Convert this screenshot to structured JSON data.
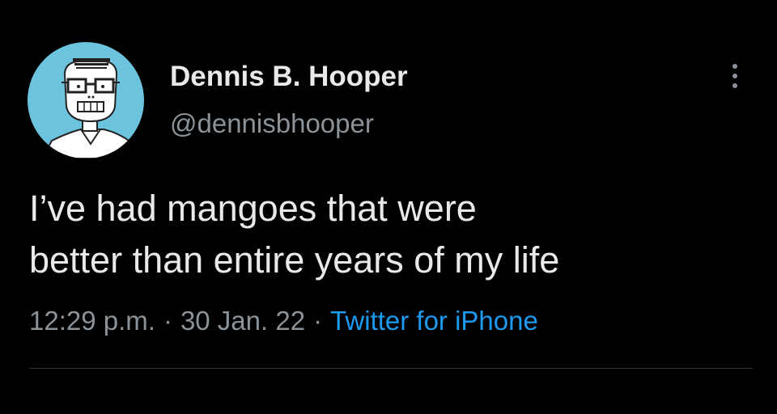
{
  "author": {
    "display_name": "Dennis B. Hooper",
    "handle": "@dennisbhooper",
    "avatar_icon": "cartoon-face-avatar",
    "avatar_bg": "#6cc3dd"
  },
  "more_icon": "more-options-icon",
  "tweet": {
    "lines": [
      "I’ve had mangoes that were",
      "better than entire years of my life"
    ]
  },
  "meta": {
    "time": "12:29 p.m.",
    "separator": "·",
    "date": "30 Jan. 22",
    "source": "Twitter for iPhone"
  },
  "colors": {
    "background": "#000000",
    "text": "#e7e9ea",
    "muted": "#8b9298",
    "link": "#1d9bf0"
  }
}
